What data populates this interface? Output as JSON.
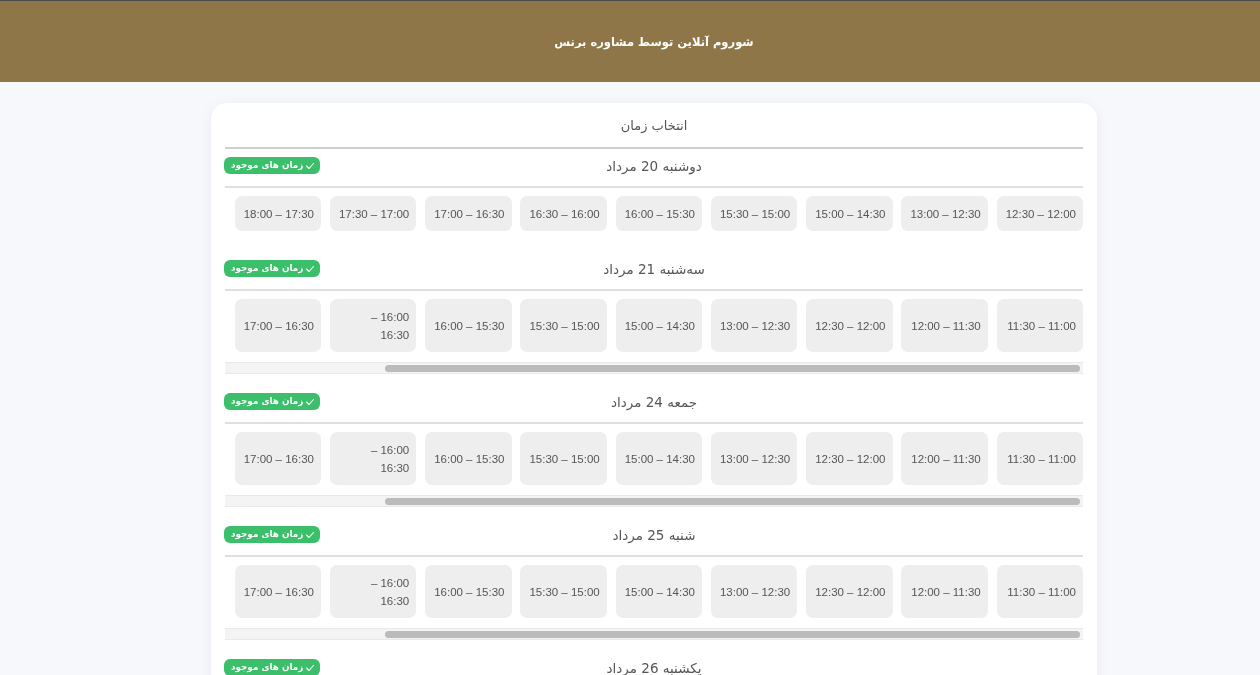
{
  "header": {
    "title": "شوروم آنلاین توسط مشاوره برنس"
  },
  "picker": {
    "title": "انتخاب زمان",
    "days": [
      {
        "title": "دوشنبه 20 مرداد",
        "badge": "زمان های موجود",
        "scrollable": false,
        "slots": [
          {
            "label": "17:30 – 18:00",
            "selected": false
          },
          {
            "label": "17:00 – 17:30",
            "selected": false
          },
          {
            "label": "16:30 – 17:00",
            "selected": false
          },
          {
            "label": "16:00 – 16:30",
            "selected": false
          },
          {
            "label": "15:30 – 16:00",
            "selected": false
          },
          {
            "label": "15:00 – 15:30",
            "selected": false
          },
          {
            "label": "14:30 – 15:00",
            "selected": false
          },
          {
            "label": "12:30 – 13:00",
            "selected": false
          },
          {
            "label": "12:00 – 12:30",
            "selected": false
          }
        ]
      },
      {
        "title": "سه‌شنبه 21 مرداد",
        "badge": "زمان های موجود",
        "scrollable": true,
        "slots": [
          {
            "label": "16:30 – 17:00",
            "selected": false
          },
          {
            "label": "16:00 –\n16:30",
            "selected": false
          },
          {
            "label": "15:30 – 16:00",
            "selected": false
          },
          {
            "label": "15:00 – 15:30",
            "selected": false
          },
          {
            "label": "14:30 – 15:00",
            "selected": false
          },
          {
            "label": "12:30 – 13:00",
            "selected": false
          },
          {
            "label": "12:00 – 12:30",
            "selected": false
          },
          {
            "label": "11:30 – 12:00",
            "selected": false
          },
          {
            "label": "11:00 – 11:30",
            "selected": false
          }
        ]
      },
      {
        "title": "جمعه 24 مرداد",
        "badge": "زمان های موجود",
        "scrollable": true,
        "slots": [
          {
            "label": "16:30 – 17:00",
            "selected": false
          },
          {
            "label": "16:00 –\n16:30",
            "selected": false
          },
          {
            "label": "15:30 – 16:00",
            "selected": false
          },
          {
            "label": "15:00 – 15:30",
            "selected": false
          },
          {
            "label": "14:30 – 15:00",
            "selected": false
          },
          {
            "label": "12:30 – 13:00",
            "selected": false
          },
          {
            "label": "12:00 – 12:30",
            "selected": false
          },
          {
            "label": "11:30 – 12:00",
            "selected": false
          },
          {
            "label": "11:00 – 11:30",
            "selected": false
          }
        ]
      },
      {
        "title": "شنبه 25 مرداد",
        "badge": "زمان های موجود",
        "scrollable": true,
        "slots": [
          {
            "label": "16:30 – 17:00",
            "selected": false
          },
          {
            "label": "16:00 –\n16:30",
            "selected": false
          },
          {
            "label": "15:30 – 16:00",
            "selected": false
          },
          {
            "label": "15:00 – 15:30",
            "selected": false
          },
          {
            "label": "14:30 – 15:00",
            "selected": false
          },
          {
            "label": "12:30 – 13:00",
            "selected": false
          },
          {
            "label": "12:00 – 12:30",
            "selected": false
          },
          {
            "label": "11:30 – 12:00",
            "selected": false
          },
          {
            "label": "11:00 – 11:30",
            "selected": false
          }
        ]
      },
      {
        "title": "یکشنبه 26 مرداد",
        "badge": "زمان های موجود"
      }
    ]
  }
}
